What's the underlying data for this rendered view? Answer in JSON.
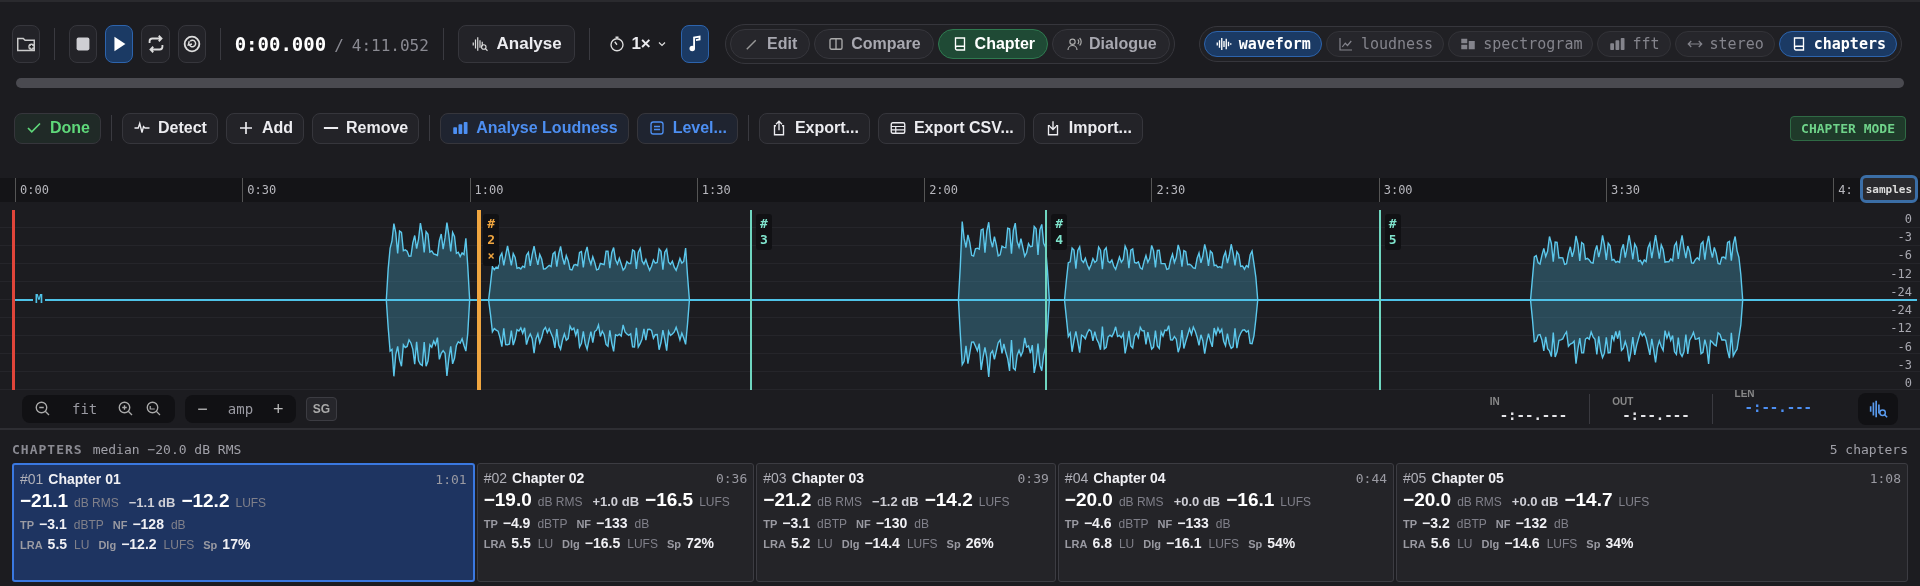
{
  "transport": [
    {
      "kind": "stop",
      "selected": false
    },
    {
      "kind": "play",
      "selected": true
    },
    {
      "kind": "loop",
      "selected": false
    },
    {
      "kind": "revert",
      "selected": false
    }
  ],
  "time": {
    "current": "0:00.000",
    "separator": "/",
    "total": "4:11.052"
  },
  "analyse_button": "Analyse",
  "speed": "1×",
  "note_toggle": {
    "on": true
  },
  "modes": [
    {
      "label": "Edit",
      "kind": "pencil",
      "selected": false
    },
    {
      "label": "Compare",
      "kind": "split",
      "selected": false
    },
    {
      "label": "Chapter",
      "kind": "book",
      "selected": true
    },
    {
      "label": "Dialogue",
      "kind": "speaker",
      "selected": false
    }
  ],
  "views": [
    {
      "label": "waveform",
      "kind": "wave",
      "selected": true
    },
    {
      "label": "loudness",
      "kind": "trend",
      "selected": false
    },
    {
      "label": "spectrogram",
      "kind": "blocks",
      "selected": false
    },
    {
      "label": "fft",
      "kind": "bars",
      "selected": false
    },
    {
      "label": "stereo",
      "kind": "arrows",
      "selected": false
    },
    {
      "label": "chapters",
      "kind": "book",
      "selected": true
    }
  ],
  "actions": [
    {
      "label": "Done",
      "kind": "check",
      "color": "#5fd87a"
    },
    {
      "label": "Detect",
      "kind": "pulse"
    },
    {
      "label": "Add",
      "kind": "plus"
    },
    {
      "label": "Remove",
      "kind": "minus"
    },
    {
      "label": "Analyse Loudness",
      "kind": "bars",
      "color": "#4d8ff2"
    },
    {
      "label": "Level...",
      "kind": "doc",
      "color": "#4d8ff2"
    },
    {
      "label": "Export...",
      "kind": "share"
    },
    {
      "label": "Export CSV...",
      "kind": "table"
    },
    {
      "label": "Import...",
      "kind": "import"
    }
  ],
  "mode_badge": "CHAPTER MODE",
  "timeline": {
    "ticks": [
      "0:00",
      "0:30",
      "1:00",
      "1:30",
      "2:00",
      "2:30",
      "3:00",
      "3:30",
      "4:"
    ],
    "samples_button": "samples",
    "channel_label": "M",
    "db_scale": [
      "0",
      "-3",
      "-6",
      "-12",
      "-24",
      "-24",
      "-12",
      "-6",
      "-3",
      "0"
    ],
    "markers": [
      {
        "hash": "#",
        "number": "2",
        "remove": "×",
        "selected": true
      },
      {
        "hash": "#",
        "number": "3",
        "selected": false
      },
      {
        "hash": "#",
        "number": "4",
        "selected": false
      },
      {
        "hash": "#",
        "number": "5",
        "selected": false
      }
    ]
  },
  "view_controls": {
    "zoom_label": "fit",
    "amp_minus": "−",
    "amp_label": "amp",
    "amp_plus": "+",
    "sg": "SG"
  },
  "readouts": [
    {
      "label": "IN",
      "value": "-:--.---",
      "active": false
    },
    {
      "label": "OUT",
      "value": "-:--.---",
      "active": false
    },
    {
      "label": "LEN",
      "value": "-:--.---",
      "active": true
    }
  ],
  "chapters": {
    "title": "CHAPTERS",
    "summary": "median −20.0 dB RMS",
    "count": "5 chapters",
    "items": [
      {
        "number": "#01",
        "title": "Chapter 01",
        "duration": "1:01",
        "selected": true,
        "main": [
          {
            "value": "−21.1",
            "unit": "dB RMS"
          },
          {
            "value": "−1.1 dB"
          },
          {
            "value": "−12.2",
            "unit": "LUFS"
          }
        ],
        "lines": [
          [
            {
              "label": "TP",
              "value": "−3.1",
              "unit": "dBTP"
            },
            {
              "label": "NF",
              "value": "−128",
              "unit": "dB"
            }
          ],
          [
            {
              "label": "LRA",
              "value": "5.5",
              "unit": "LU"
            },
            {
              "label": "Dlg",
              "value": "−12.2",
              "unit": "LUFS"
            },
            {
              "label": "Sp",
              "value": "17%"
            }
          ]
        ]
      },
      {
        "number": "#02",
        "title": "Chapter 02",
        "duration": "0:36",
        "selected": false,
        "main": [
          {
            "value": "−19.0",
            "unit": "dB RMS"
          },
          {
            "value": "+1.0 dB"
          },
          {
            "value": "−16.5",
            "unit": "LUFS"
          }
        ],
        "lines": [
          [
            {
              "label": "TP",
              "value": "−4.9",
              "unit": "dBTP"
            },
            {
              "label": "NF",
              "value": "−133",
              "unit": "dB"
            }
          ],
          [
            {
              "label": "LRA",
              "value": "5.5",
              "unit": "LU"
            },
            {
              "label": "Dlg",
              "value": "−16.5",
              "unit": "LUFS"
            },
            {
              "label": "Sp",
              "value": "72%"
            }
          ]
        ]
      },
      {
        "number": "#03",
        "title": "Chapter 03",
        "duration": "0:39",
        "selected": false,
        "main": [
          {
            "value": "−21.2",
            "unit": "dB RMS"
          },
          {
            "value": "−1.2 dB"
          },
          {
            "value": "−14.2",
            "unit": "LUFS"
          }
        ],
        "lines": [
          [
            {
              "label": "TP",
              "value": "−3.1",
              "unit": "dBTP"
            },
            {
              "label": "NF",
              "value": "−130",
              "unit": "dB"
            }
          ],
          [
            {
              "label": "LRA",
              "value": "5.2",
              "unit": "LU"
            },
            {
              "label": "Dlg",
              "value": "−14.4",
              "unit": "LUFS"
            },
            {
              "label": "Sp",
              "value": "26%"
            }
          ]
        ]
      },
      {
        "number": "#04",
        "title": "Chapter 04",
        "duration": "0:44",
        "selected": false,
        "main": [
          {
            "value": "−20.0",
            "unit": "dB RMS"
          },
          {
            "value": "+0.0 dB"
          },
          {
            "value": "−16.1",
            "unit": "LUFS"
          }
        ],
        "lines": [
          [
            {
              "label": "TP",
              "value": "−4.6",
              "unit": "dBTP"
            },
            {
              "label": "NF",
              "value": "−133",
              "unit": "dB"
            }
          ],
          [
            {
              "label": "LRA",
              "value": "6.8",
              "unit": "LU"
            },
            {
              "label": "Dlg",
              "value": "−16.1",
              "unit": "LUFS"
            },
            {
              "label": "Sp",
              "value": "54%"
            }
          ]
        ]
      },
      {
        "number": "#05",
        "title": "Chapter 05",
        "duration": "1:08",
        "selected": false,
        "main": [
          {
            "value": "−20.0",
            "unit": "dB RMS"
          },
          {
            "value": "+0.0 dB"
          },
          {
            "value": "−14.7",
            "unit": "LUFS"
          }
        ],
        "lines": [
          [
            {
              "label": "TP",
              "value": "−3.2",
              "unit": "dBTP"
            },
            {
              "label": "NF",
              "value": "−132",
              "unit": "dB"
            }
          ],
          [
            {
              "label": "LRA",
              "value": "5.6",
              "unit": "LU"
            },
            {
              "label": "Dlg",
              "value": "−14.6",
              "unit": "LUFS"
            },
            {
              "label": "Sp",
              "value": "34%"
            }
          ]
        ]
      }
    ]
  }
}
